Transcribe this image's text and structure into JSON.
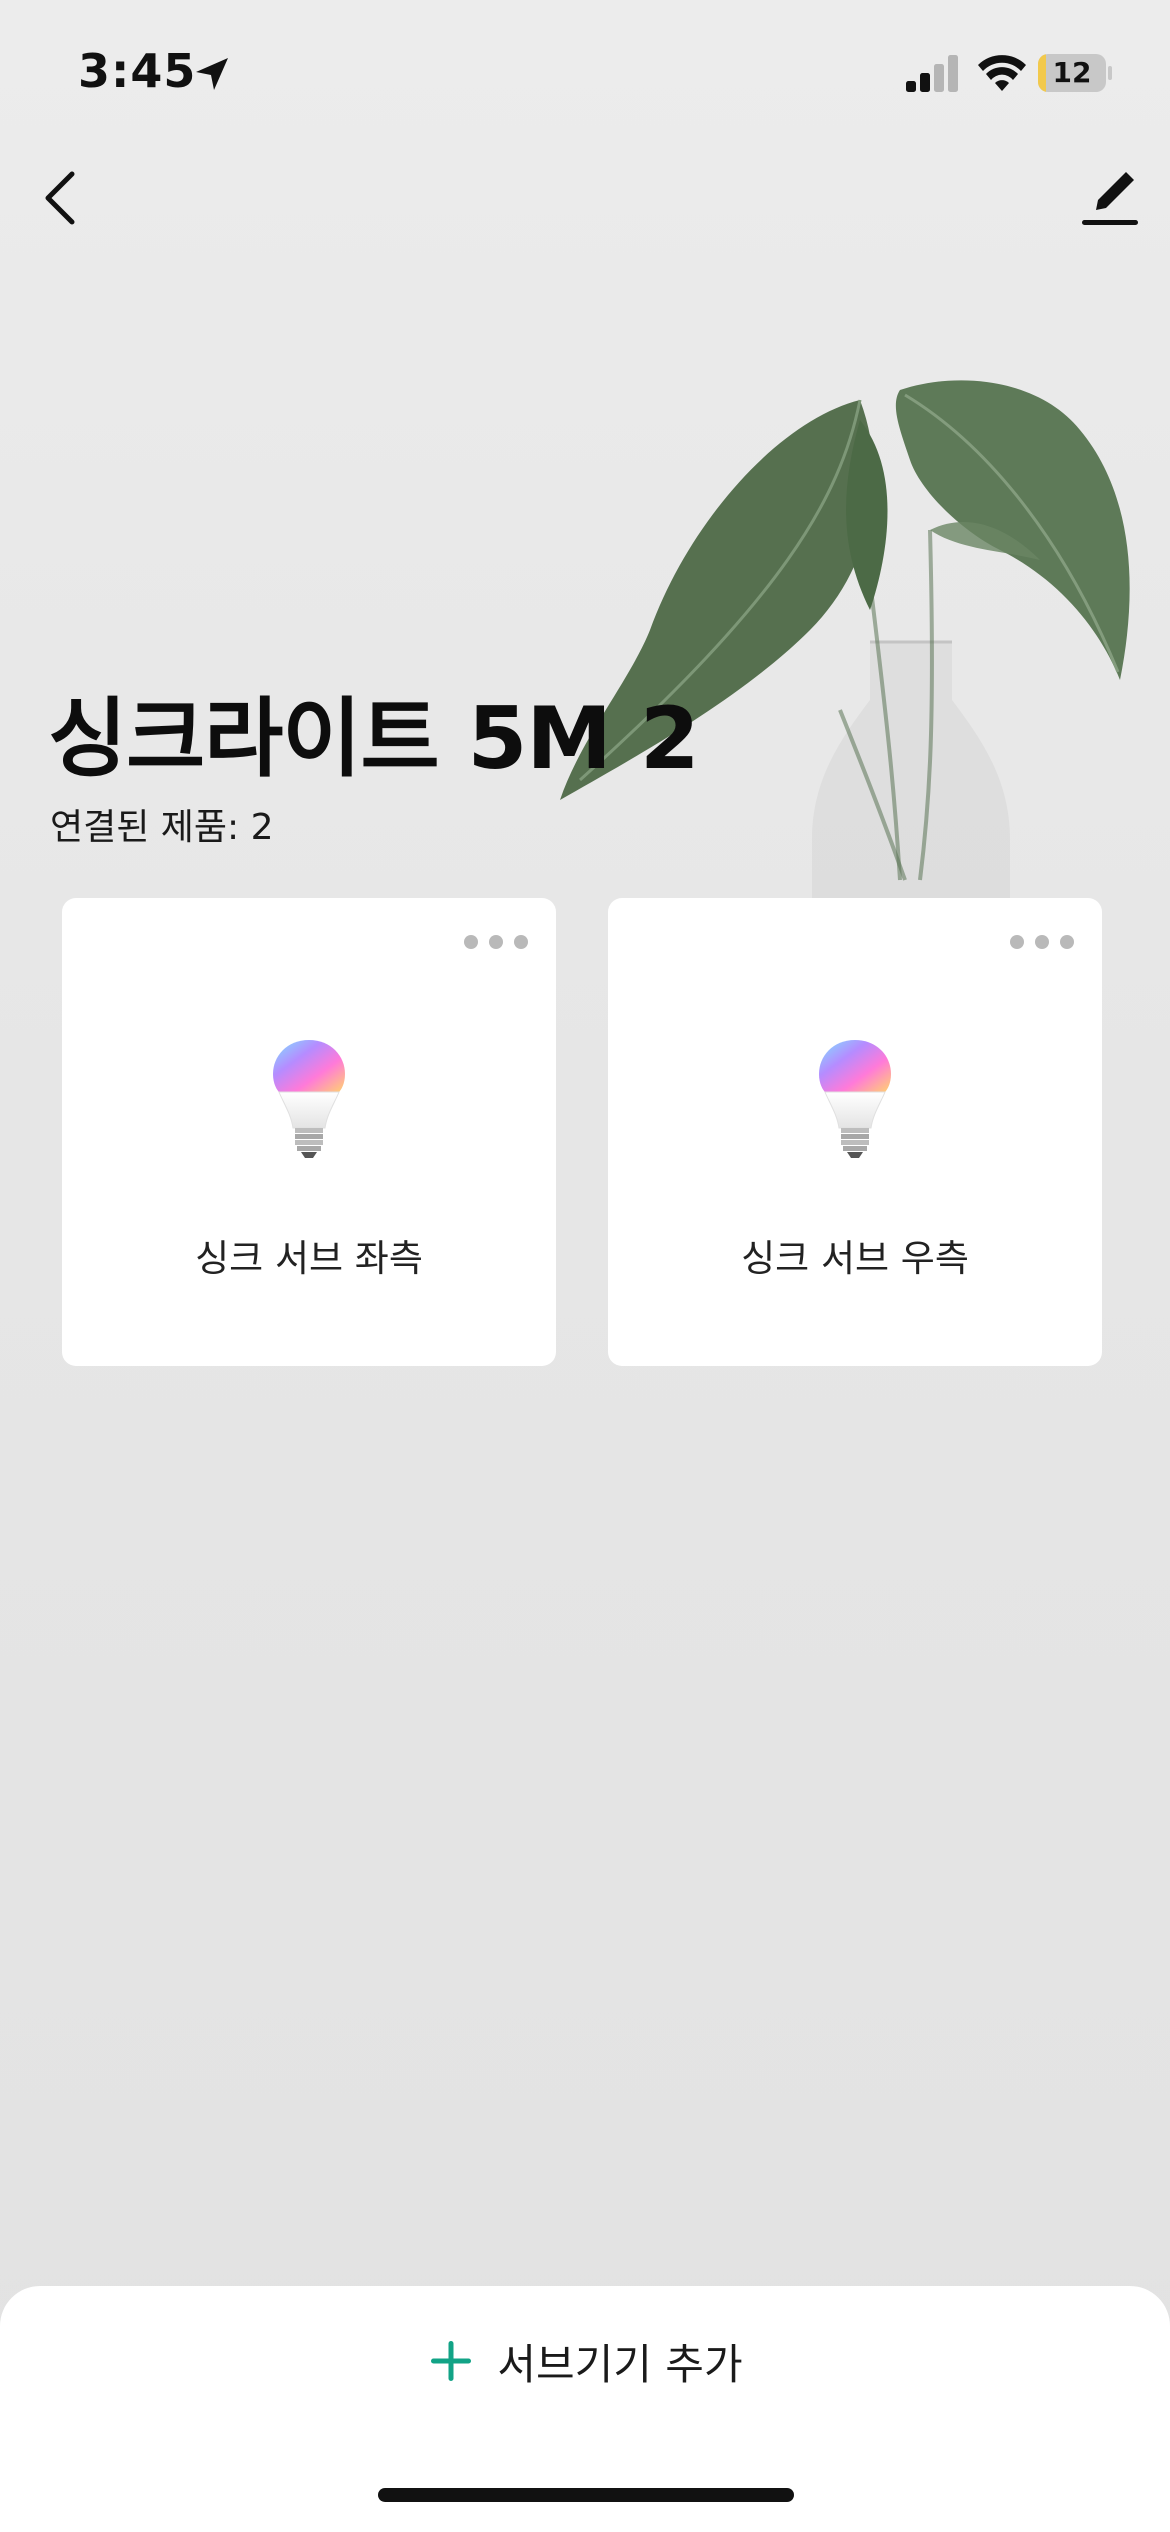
{
  "status_bar": {
    "time": "3:45",
    "battery_level": "12",
    "battery_fraction": 0.12,
    "location_icon": "location-arrow-icon",
    "signal_icon": "cellular-signal-icon",
    "wifi_icon": "wifi-icon"
  },
  "nav": {
    "back_icon": "chevron-left-icon",
    "edit_icon": "pencil-icon"
  },
  "group": {
    "title": "싱크라이트 5M 2",
    "subtitle": "연결된 제품: 2"
  },
  "devices": [
    {
      "name": "싱크 서브 좌측",
      "icon": "rgb-bulb-icon"
    },
    {
      "name": "싱크 서브 우측",
      "icon": "rgb-bulb-icon"
    }
  ],
  "bottom_sheet": {
    "add_label": "서브기기 추가",
    "add_icon": "plus-icon"
  },
  "colors": {
    "accent": "#12a386",
    "battery_fill": "#f2c94c",
    "card_background": "#ffffff",
    "page_background": "#e6e6e6"
  }
}
